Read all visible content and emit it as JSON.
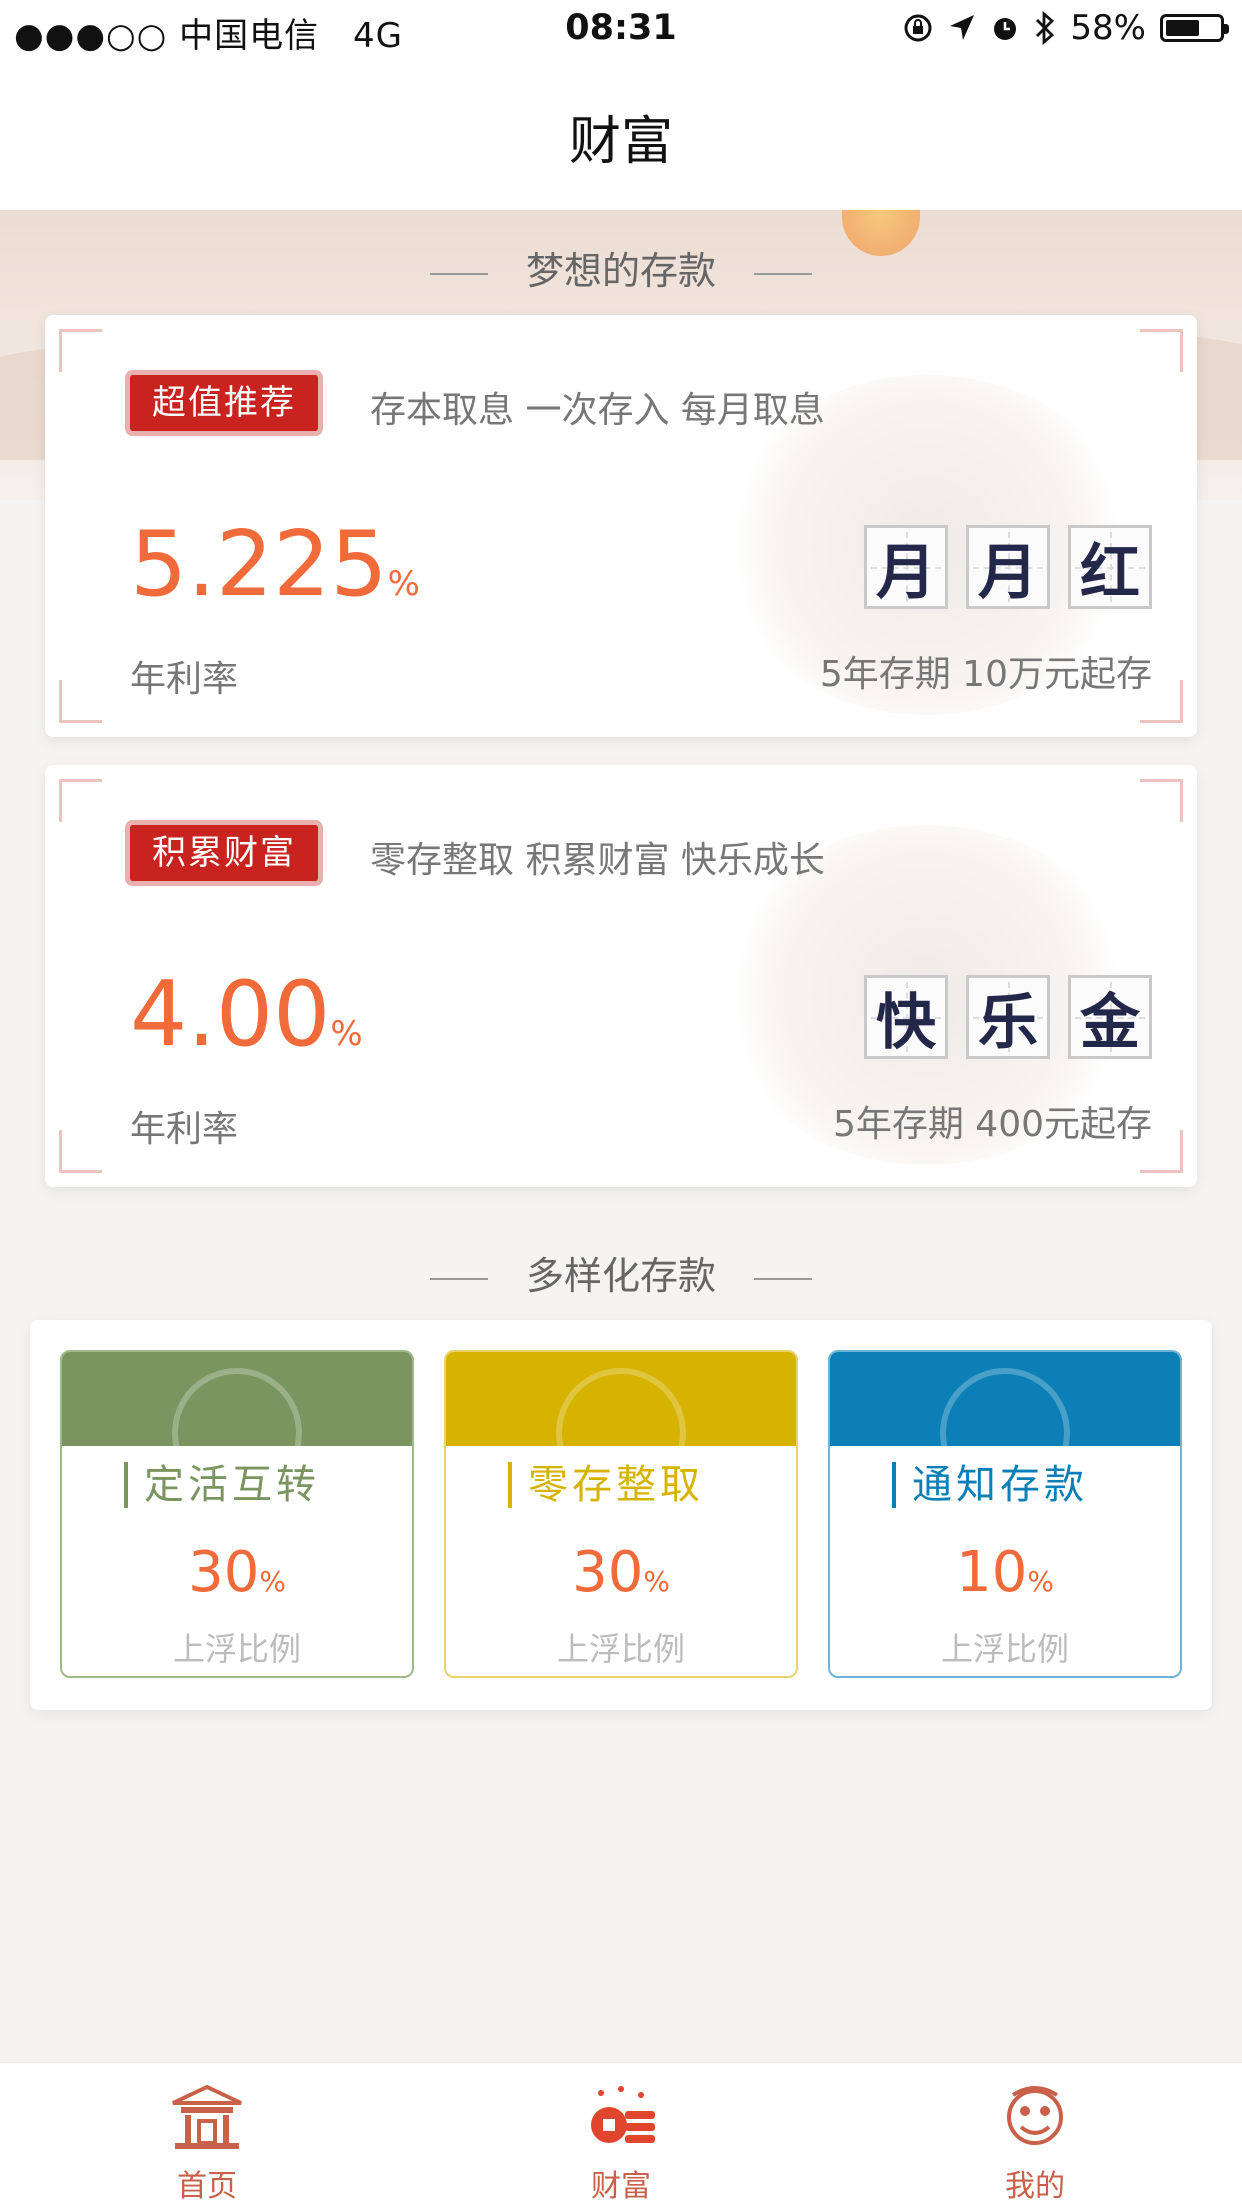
{
  "status_bar": {
    "carrier": "●●●○○ 中国电信",
    "network": "4G",
    "time": "08:31",
    "battery": "58%"
  },
  "header": {
    "title": "财富"
  },
  "section_dream": {
    "title": "梦想的存款"
  },
  "products": [
    {
      "tag": "超值推荐",
      "slogan": "存本取息 一次存入 每月取息",
      "rate": "5.225",
      "unit": "%",
      "rate_label": "年利率",
      "glyphs": [
        "月",
        "月",
        "红"
      ],
      "term": "5年存期 10万元起存"
    },
    {
      "tag": "积累财富",
      "slogan": "零存整取 积累财富 快乐成长",
      "rate": "4.00",
      "unit": "%",
      "rate_label": "年利率",
      "glyphs": [
        "快",
        "乐",
        "金"
      ],
      "term": "5年存期 400元起存"
    }
  ],
  "section_diverse": {
    "title": "多样化存款"
  },
  "deposits": [
    {
      "name": "定活互转",
      "value": "30",
      "unit": "%",
      "label": "上浮比例",
      "color": "#7a9560"
    },
    {
      "name": "零存整取",
      "value": "30",
      "unit": "%",
      "label": "上浮比例",
      "color": "#d6b300"
    },
    {
      "name": "通知存款",
      "value": "10",
      "unit": "%",
      "label": "上浮比例",
      "color": "#0b7fb6"
    }
  ],
  "tabbar": {
    "items": [
      {
        "label": "首页",
        "icon": "temple-icon"
      },
      {
        "label": "财富",
        "icon": "coins-icon"
      },
      {
        "label": "我的",
        "icon": "lion-icon"
      }
    ]
  },
  "colors": {
    "accent": "#f06a3a",
    "stamp_red": "#c8231e",
    "tab_active": "#c8604a"
  }
}
